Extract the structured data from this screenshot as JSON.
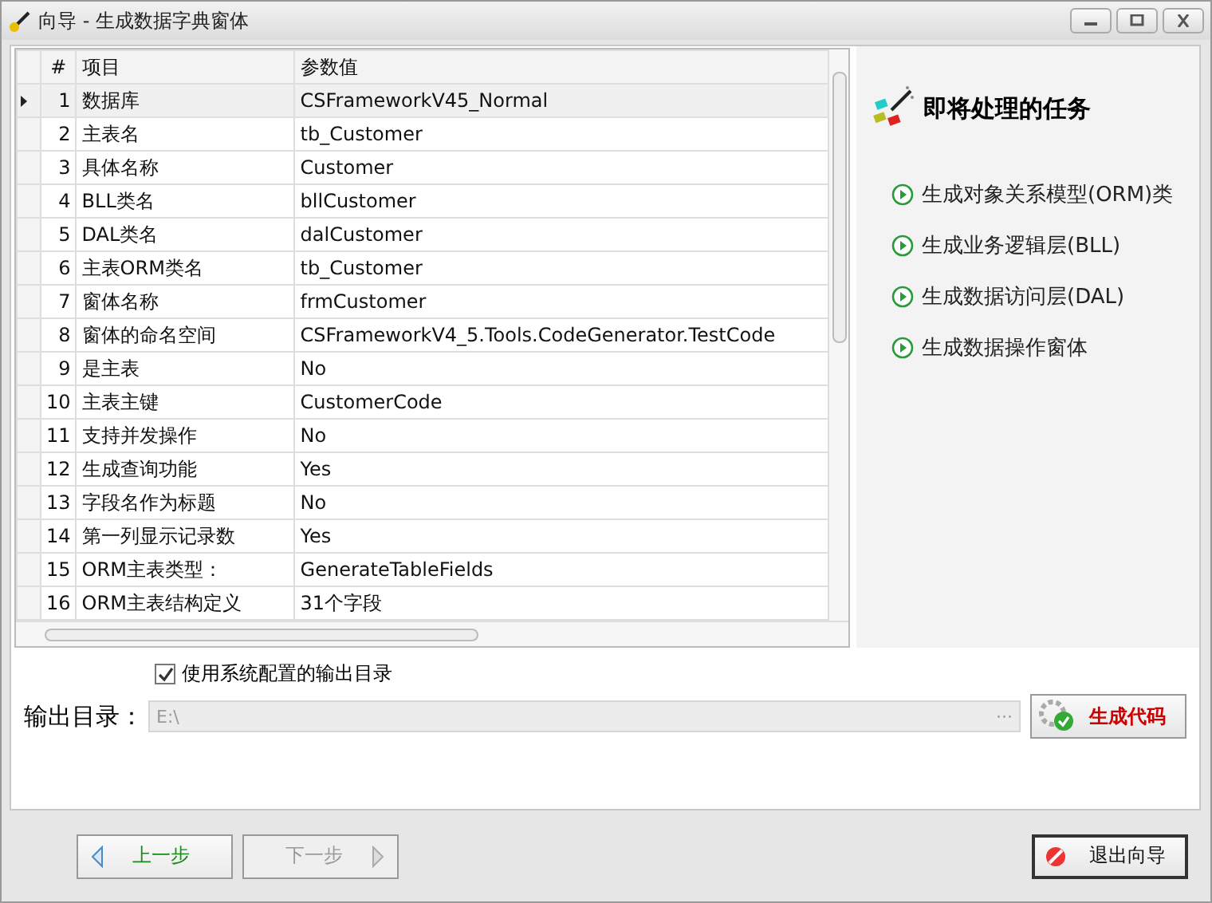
{
  "window": {
    "title": "向导 - 生成数据字典窗体"
  },
  "grid": {
    "columns": [
      "#",
      "项目",
      "参数值"
    ],
    "rows": [
      {
        "num": "1",
        "item": "数据库",
        "value": "CSFrameworkV45_Normal",
        "selected": true
      },
      {
        "num": "2",
        "item": "主表名",
        "value": "tb_Customer",
        "selected": false
      },
      {
        "num": "3",
        "item": "具体名称",
        "value": "Customer",
        "selected": false
      },
      {
        "num": "4",
        "item": "BLL类名",
        "value": "bllCustomer",
        "selected": false
      },
      {
        "num": "5",
        "item": "DAL类名",
        "value": "dalCustomer",
        "selected": false
      },
      {
        "num": "6",
        "item": "主表ORM类名",
        "value": "tb_Customer",
        "selected": false
      },
      {
        "num": "7",
        "item": "窗体名称",
        "value": "frmCustomer",
        "selected": false
      },
      {
        "num": "8",
        "item": "窗体的命名空间",
        "value": "CSFrameworkV4_5.Tools.CodeGenerator.TestCode",
        "selected": false
      },
      {
        "num": "9",
        "item": "是主表",
        "value": "No",
        "selected": false
      },
      {
        "num": "10",
        "item": "主表主键",
        "value": "CustomerCode",
        "selected": false
      },
      {
        "num": "11",
        "item": "支持并发操作",
        "value": "No",
        "selected": false
      },
      {
        "num": "12",
        "item": "生成查询功能",
        "value": "Yes",
        "selected": false
      },
      {
        "num": "13",
        "item": "字段名作为标题",
        "value": "No",
        "selected": false
      },
      {
        "num": "14",
        "item": "第一列显示记录数",
        "value": "Yes",
        "selected": false
      },
      {
        "num": "15",
        "item": "ORM主表类型：",
        "value": "GenerateTableFields",
        "selected": false
      },
      {
        "num": "16",
        "item": "ORM主表结构定义",
        "value": "31个字段",
        "selected": false
      }
    ]
  },
  "tasks": {
    "title": "即将处理的任务",
    "items": [
      "生成对象关系模型(ORM)类",
      "生成业务逻辑层(BLL)",
      "生成数据访问层(DAL)",
      "生成数据操作窗体"
    ]
  },
  "output": {
    "use_system_dir": {
      "label": "使用系统配置的输出目录",
      "checked": true
    },
    "label": "输出目录：",
    "path": "E:\\",
    "browse": "···",
    "generate_button": "生成代码"
  },
  "footer": {
    "prev": {
      "label": "上一步",
      "disabled": false
    },
    "next": {
      "label": "下一步",
      "disabled": true
    },
    "exit": "退出向导"
  }
}
